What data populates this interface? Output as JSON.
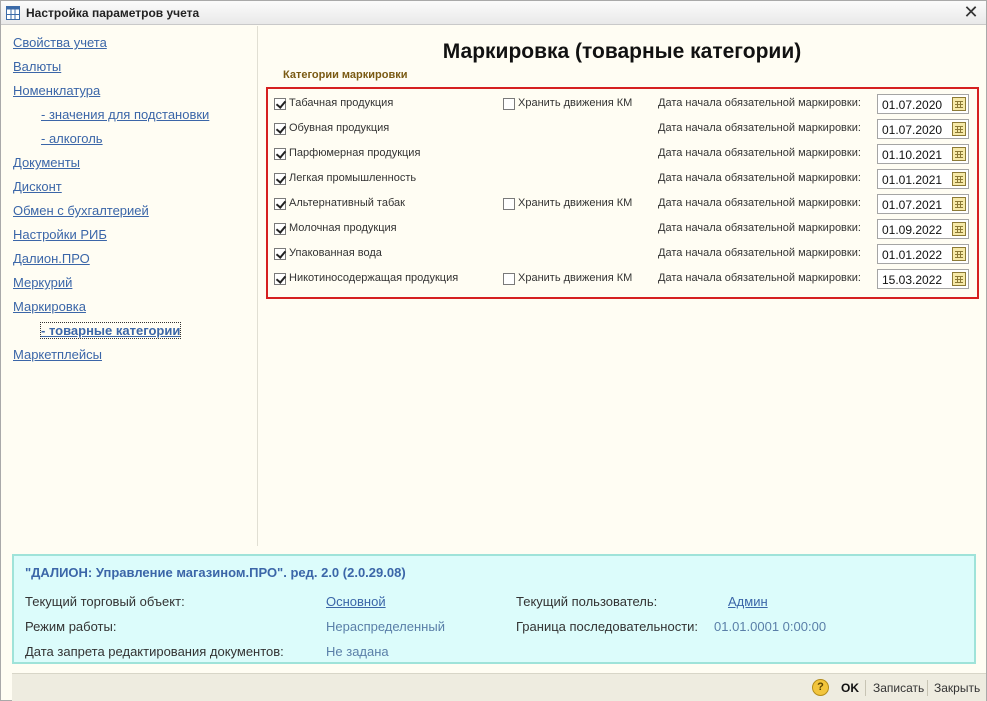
{
  "window": {
    "title": "Настройка параметров учета",
    "close_glyph": "✕"
  },
  "sidebar": {
    "items": [
      {
        "label": "Свойства учета"
      },
      {
        "label": "Валюты"
      },
      {
        "label": "Номенклатура"
      },
      {
        "label": "- значения для подстановки"
      },
      {
        "label": "- алкоголь"
      },
      {
        "label": "Документы"
      },
      {
        "label": "Дисконт"
      },
      {
        "label": "Обмен с бухгалтерией"
      },
      {
        "label": "Настройки РИБ"
      },
      {
        "label": "Далион.ПРО"
      },
      {
        "label": "Меркурий"
      },
      {
        "label": "Маркировка"
      },
      {
        "label": "- товарные категории"
      },
      {
        "label": "Маркетплейсы"
      }
    ],
    "active_item": "- товарные категории"
  },
  "main": {
    "title": "Маркировка (товарные категории)",
    "group_label": "Категории маркировки",
    "date_label": "Дата начала обязательной маркировки:",
    "store_km_label": "Хранить движения КМ",
    "categories": [
      {
        "name": "Табачная продукция",
        "checked": true,
        "store_km": false,
        "date": "01.07.2020"
      },
      {
        "name": "Обувная продукция",
        "checked": true,
        "date": "01.07.2020"
      },
      {
        "name": "Парфюмерная продукция",
        "checked": true,
        "date": "01.10.2021"
      },
      {
        "name": "Легкая промышленность",
        "checked": true,
        "date": "01.01.2021"
      },
      {
        "name": "Альтернативный табак",
        "checked": true,
        "store_km": false,
        "date": "01.07.2021"
      },
      {
        "name": "Молочная продукция",
        "checked": true,
        "date": "01.09.2022"
      },
      {
        "name": "Упакованная вода",
        "checked": true,
        "date": "01.01.2022"
      },
      {
        "name": "Никотиносодержащая продукция",
        "checked": true,
        "store_km": false,
        "date": "15.03.2022"
      }
    ]
  },
  "info": {
    "title": "\"ДАЛИОН: Управление магазином.ПРО\". ред. 2.0 (2.0.29.08)",
    "trade_object_label": "Текущий торговый объект:",
    "trade_object_value": "Основной",
    "mode_label": "Режим работы:",
    "mode_value": "Нераспределенный",
    "edit_lock_label": "Дата запрета редактирования документов:",
    "edit_lock_value": "Не задана",
    "user_label": "Текущий пользователь:",
    "user_value": "Админ",
    "sequence_label": "Граница последовательности:",
    "sequence_value": "01.01.0001 0:00:00"
  },
  "footer": {
    "help_glyph": "?",
    "ok_label": "OK",
    "save_label": "Записать",
    "close_label": "Закрыть"
  },
  "colors": {
    "background": "#fffdf3",
    "link": "#3b66a8",
    "highlight_frame": "#d62020",
    "info_background": "#dcfcfb",
    "group_label": "#7a5a13"
  },
  "icons": {
    "title_icon": "grid-table-icon",
    "calendar_icon": "calendar-icon",
    "help_icon": "help-icon",
    "close_icon": "close-icon"
  }
}
